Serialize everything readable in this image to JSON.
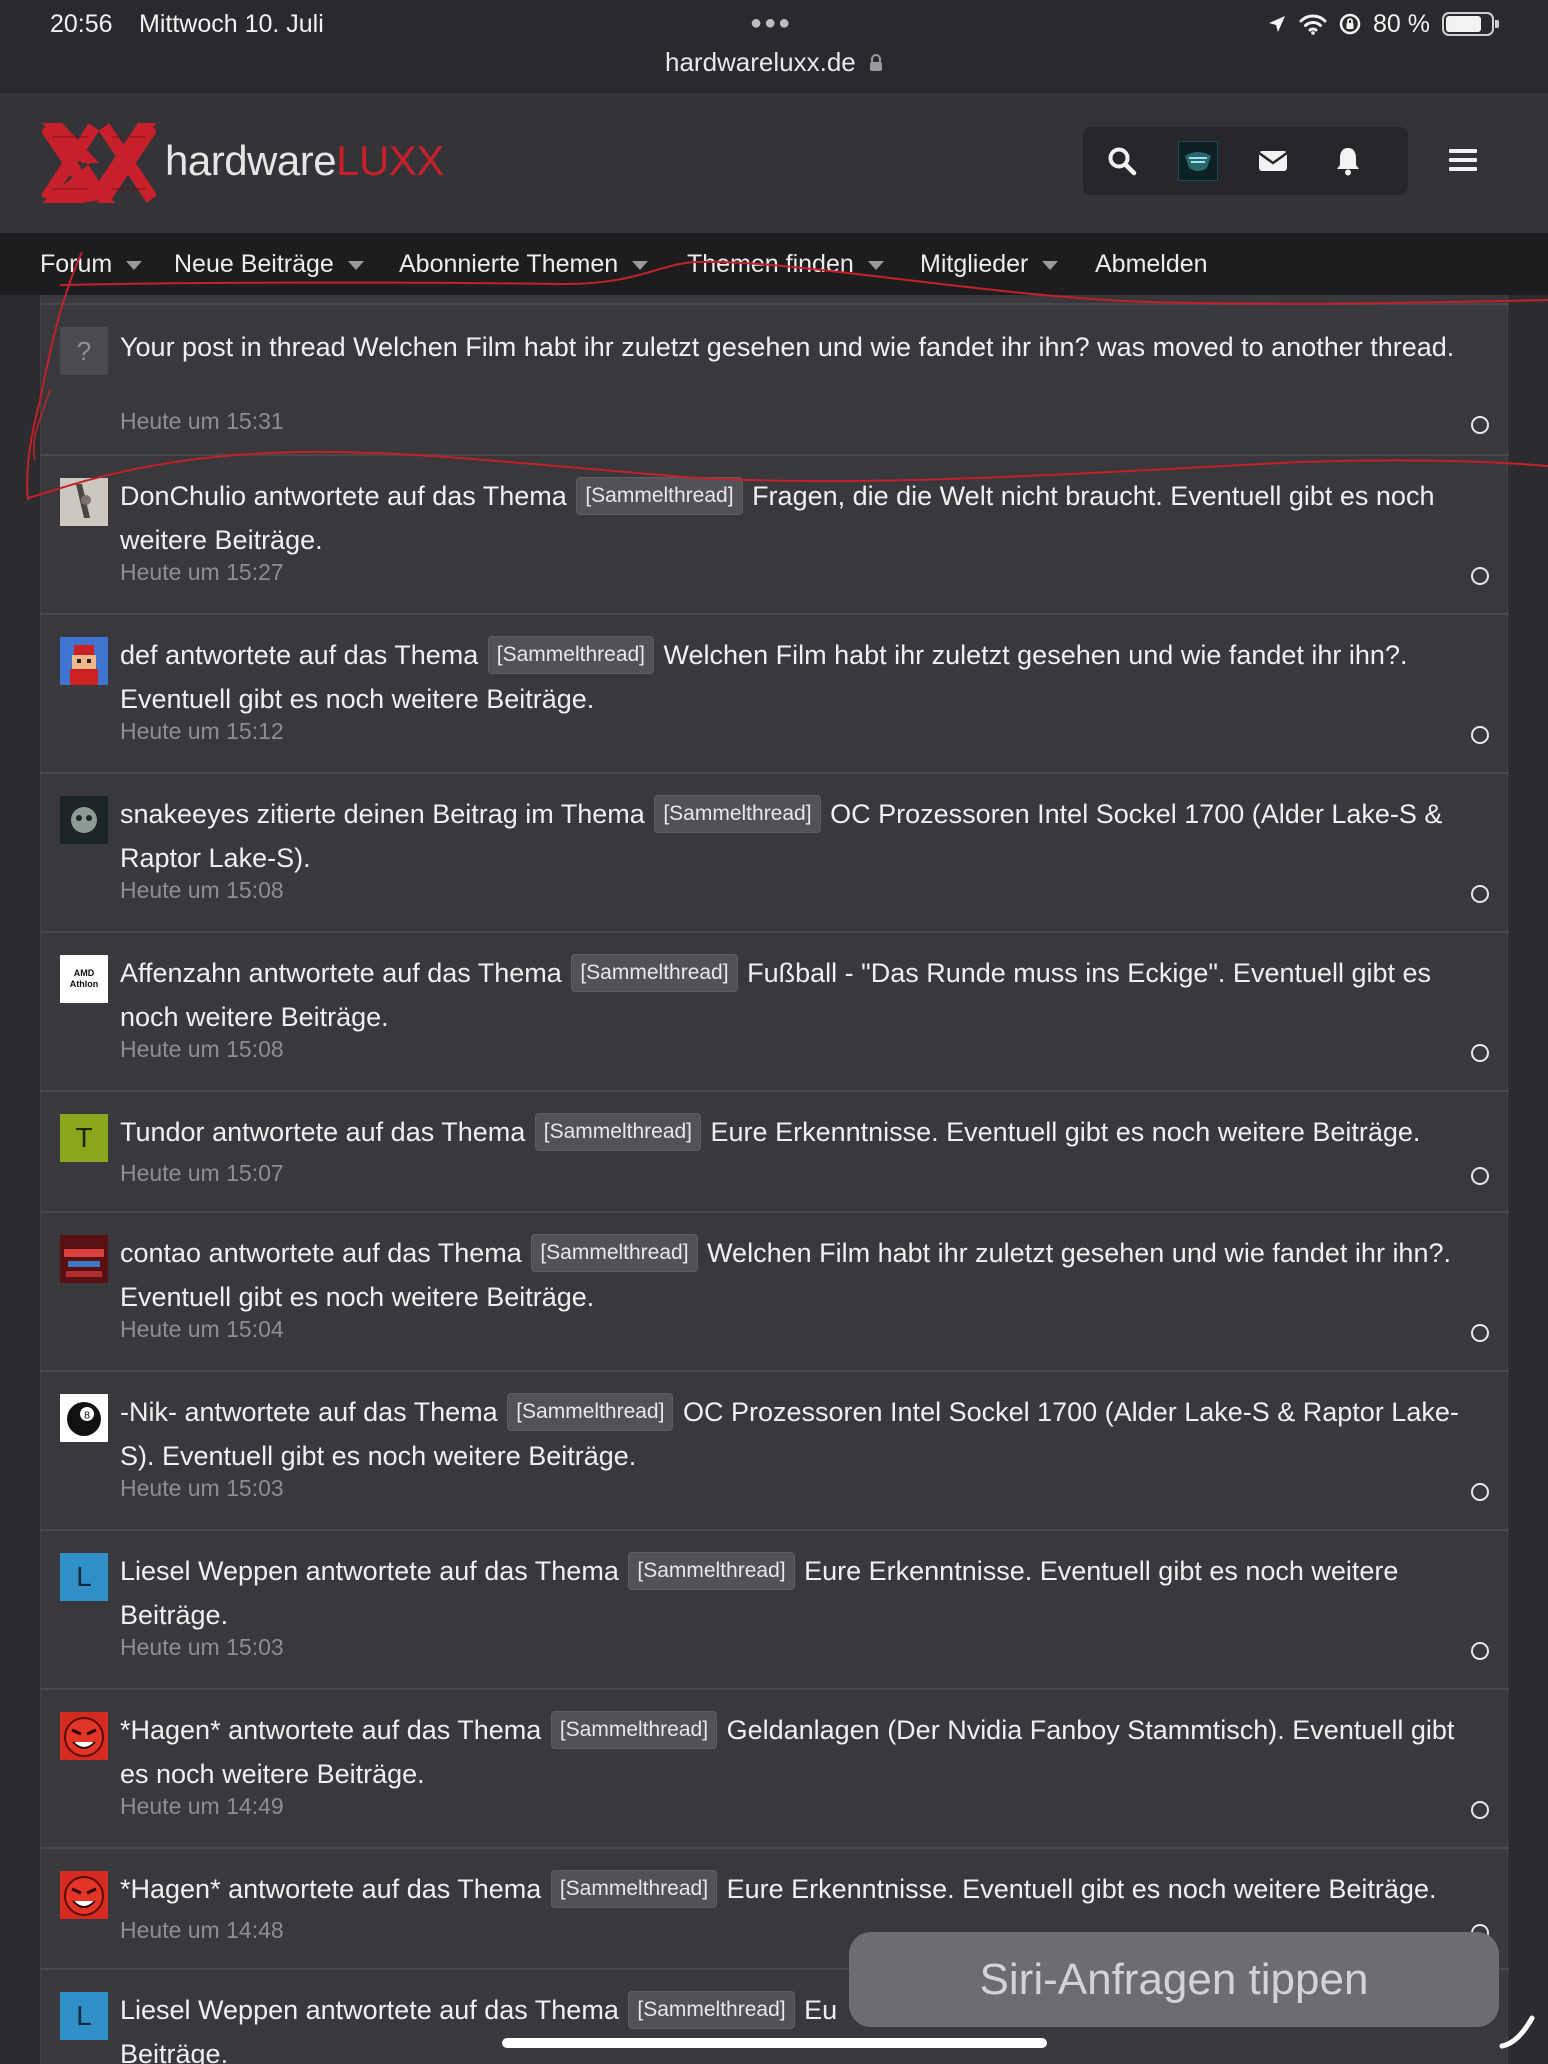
{
  "status_bar": {
    "time": "20:56",
    "date": "Mittwoch 10. Juli",
    "url": "hardwareluxx.de",
    "battery": "80 %"
  },
  "site": {
    "logo_part1": "hardware",
    "logo_part2": "LUXX",
    "brand_color": "#c8202a"
  },
  "header_icons": [
    "search-icon",
    "avatar",
    "envelope-icon",
    "bell-icon",
    "menu-icon"
  ],
  "nav": {
    "items": [
      {
        "label": "Forum"
      },
      {
        "label": "Neue Beiträge"
      },
      {
        "label": "Abonnierte Themen"
      },
      {
        "label": "Themen finden"
      },
      {
        "label": "Mitglieder"
      },
      {
        "label": "Abmelden"
      }
    ]
  },
  "alerts": [
    {
      "text": "Your post in thread Welchen Film habt ihr zuletzt gesehen und wie fandet ihr ihn? was moved to another thread.",
      "time": "Heute um 15:31",
      "avatar_letter": "?"
    },
    {
      "user": "DonChulio",
      "action": "antwortete auf das Thema",
      "prefix": "[Sammelthread]",
      "title": "Fragen, die die Welt nicht braucht. Eventuell gibt es noch weitere Beiträge.",
      "time": "Heute um 15:27"
    },
    {
      "user": "def",
      "action": "antwortete auf das Thema",
      "prefix": "[Sammelthread]",
      "title": "Welchen Film habt ihr zuletzt gesehen und wie fandet ihr ihn?. Eventuell gibt es noch weitere Beiträge.",
      "time": "Heute um 15:12"
    },
    {
      "user": "snakeeyes",
      "action": "zitierte deinen Beitrag im Thema",
      "prefix": "[Sammelthread]",
      "title": "OC Prozessoren Intel Sockel 1700 (Alder Lake-S & Raptor Lake-S).",
      "time": "Heute um 15:08"
    },
    {
      "user": "Affenzahn",
      "action": "antwortete auf das Thema",
      "prefix": "[Sammelthread]",
      "title": "Fußball - \"Das Runde muss ins Eckige\". Eventuell gibt es noch weitere Beiträge.",
      "time": "Heute um 15:08",
      "avatar_text": "AMD Athlon"
    },
    {
      "user": "Tundor",
      "action": "antwortete auf das Thema",
      "prefix": "[Sammelthread]",
      "title": "Eure Erkenntnisse. Eventuell gibt es noch weitere Beiträge.",
      "time": "Heute um 15:07",
      "avatar_letter": "T"
    },
    {
      "user": "contao",
      "action": "antwortete auf das Thema",
      "prefix": "[Sammelthread]",
      "title": "Welchen Film habt ihr zuletzt gesehen und wie fandet ihr ihn?. Eventuell gibt es noch weitere Beiträge.",
      "time": "Heute um 15:04"
    },
    {
      "user": "-Nik-",
      "action": "antwortete auf das Thema",
      "prefix": "[Sammelthread]",
      "title": "OC Prozessoren Intel Sockel 1700 (Alder Lake-S & Raptor Lake-S). Eventuell gibt es noch weitere Beiträge.",
      "time": "Heute um 15:03"
    },
    {
      "user": "Liesel Weppen",
      "action": "antwortete auf das Thema",
      "prefix": "[Sammelthread]",
      "title": "Eure Erkenntnisse. Eventuell gibt es noch weitere Beiträge.",
      "time": "Heute um 15:03",
      "avatar_letter": "L"
    },
    {
      "user": "*Hagen*",
      "action": "antwortete auf das Thema",
      "prefix": "[Sammelthread]",
      "title": "Geldanlagen (Der Nvidia Fanboy Stammtisch). Eventuell gibt es noch weitere Beiträge.",
      "time": "Heute um 14:49"
    },
    {
      "user": "*Hagen*",
      "action": "antwortete auf das Thema",
      "prefix": "[Sammelthread]",
      "title": "Eure Erkenntnisse. Eventuell gibt es noch weitere Beiträge.",
      "time": "Heute um 14:48"
    },
    {
      "user": "Liesel Weppen",
      "action": "antwortete auf das Thema",
      "prefix": "[Sammelthread]",
      "title": "Eu",
      "title_tail": "Beiträge.",
      "avatar_letter": "L"
    }
  ],
  "siri_hint": "Siri-Anfragen tippen"
}
